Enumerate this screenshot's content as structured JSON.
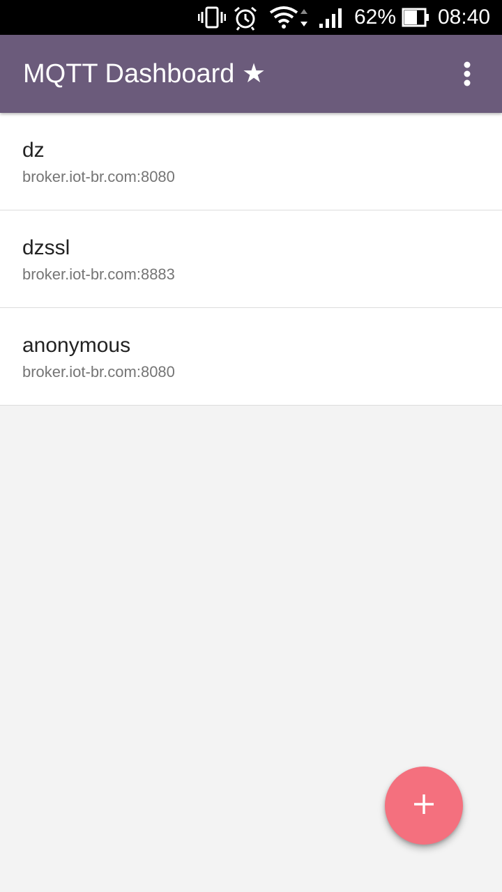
{
  "status_bar": {
    "battery_text": "62%",
    "time": "08:40",
    "icons": [
      "vibrate-icon",
      "alarm-icon",
      "wifi-icon",
      "signal-icon",
      "battery-icon"
    ]
  },
  "app_bar": {
    "title": "MQTT Dashboard ★",
    "overflow_icon": "more-vert-icon",
    "color": "#6b5b7b"
  },
  "connections": [
    {
      "name": "dz",
      "host": "broker.iot-br.com:8080"
    },
    {
      "name": "dzssl",
      "host": "broker.iot-br.com:8883"
    },
    {
      "name": "anonymous",
      "host": "broker.iot-br.com:8080"
    }
  ],
  "fab": {
    "icon": "plus-icon",
    "color": "#f4707e"
  }
}
